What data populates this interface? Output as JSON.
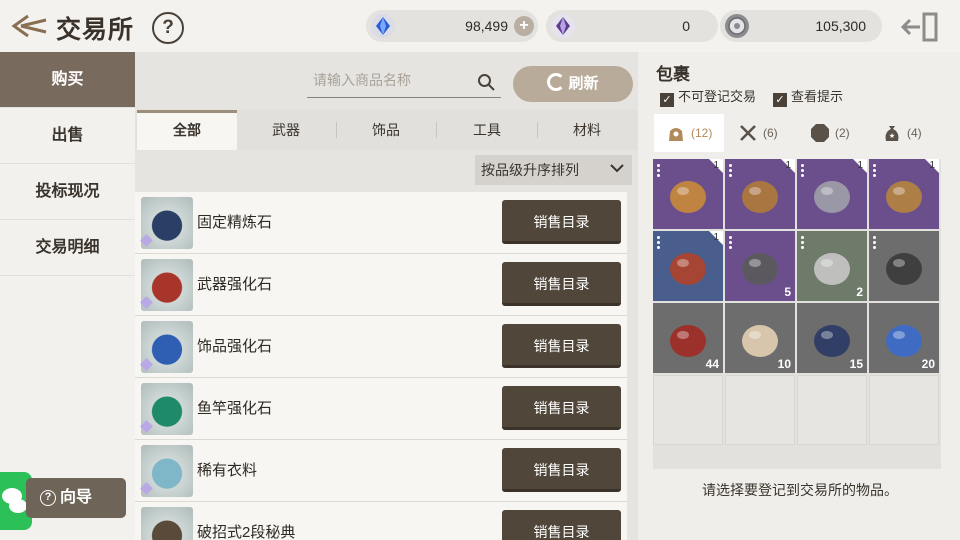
{
  "header": {
    "title": "交易所",
    "help_label": "?",
    "currencies": [
      {
        "name": "blue-crystal-icon",
        "value": "98,499",
        "has_plus": true
      },
      {
        "name": "purple-crystal-icon",
        "value": "0",
        "has_plus": false
      },
      {
        "name": "silver-coin-icon",
        "value": "105,300",
        "has_plus": false
      }
    ]
  },
  "nav": {
    "items": [
      {
        "label": "购买",
        "active": true
      },
      {
        "label": "出售",
        "active": false
      },
      {
        "label": "投标现况",
        "active": false
      },
      {
        "label": "交易明细",
        "active": false
      }
    ],
    "guide_label": "向导"
  },
  "market": {
    "search_placeholder": "请输入商品名称",
    "refresh_label": "刷新",
    "tabs": [
      "全部",
      "武器",
      "饰品",
      "工具",
      "材料"
    ],
    "active_tab": 0,
    "sort_label": "按品级升序排列",
    "rows": [
      {
        "name": "固定精炼石",
        "button": "销售目录",
        "color": "#2a3f66"
      },
      {
        "name": "武器强化石",
        "button": "销售目录",
        "color": "#a8352a"
      },
      {
        "name": "饰品强化石",
        "button": "销售目录",
        "color": "#2f5fb2"
      },
      {
        "name": "鱼竿强化石",
        "button": "销售目录",
        "color": "#1f8a6a"
      },
      {
        "name": "稀有衣料",
        "button": "销售目录",
        "color": "#7fb6c8"
      },
      {
        "name": "破招式2段秘典",
        "button": "销售目录",
        "color": "#5a4a3a"
      }
    ]
  },
  "bag": {
    "title": "包裹",
    "checkbox_1": "不可登记交易",
    "checkbox_2": "查看提示",
    "tabs": [
      {
        "icon": "bag-icon",
        "count": "(12)",
        "active": true
      },
      {
        "icon": "swords-icon",
        "count": "(6)",
        "active": false
      },
      {
        "icon": "octagon-icon",
        "count": "(2)",
        "active": false
      },
      {
        "icon": "pouch-icon",
        "count": "(4)",
        "active": false
      }
    ],
    "hint": "请选择要登记到交易所的物品。",
    "items": [
      {
        "name": "amulet-item",
        "qty": "1",
        "bg": "#6b4f8c",
        "fg": "#c9883a"
      },
      {
        "name": "earring-item",
        "qty": "1",
        "bg": "#6b4f8c",
        "fg": "#b07a3a"
      },
      {
        "name": "ring-item",
        "qty": "1",
        "bg": "#6b4f8c",
        "fg": "#a0a0a8"
      },
      {
        "name": "bracelet-item",
        "qty": "1",
        "bg": "#6b4f8c",
        "fg": "#b5833e"
      },
      {
        "name": "weapon-item",
        "qty": "1",
        "bg": "#4a5e8e",
        "fg": "#b0422a"
      },
      {
        "name": "chest-item",
        "qty": "5",
        "bg": "#6b4f8c",
        "fg": "#5a5a5a"
      },
      {
        "name": "pearl-item",
        "qty": "2",
        "bg": "#6f7b6a",
        "fg": "#c8c8c8"
      },
      {
        "name": "dagger-item",
        "qty": "",
        "bg": "#6d6d6d",
        "fg": "#3a3a3a"
      },
      {
        "name": "potion-item",
        "qty": "44",
        "bg": "#6d6d6d",
        "fg": "#a02a22"
      },
      {
        "name": "bun-item",
        "qty": "10",
        "bg": "#6d6d6d",
        "fg": "#e3cfb2"
      },
      {
        "name": "ore-item",
        "qty": "15",
        "bg": "#6d6d6d",
        "fg": "#2a3a66"
      },
      {
        "name": "flask-item",
        "qty": "20",
        "bg": "#6d6d6d",
        "fg": "#3a6acc"
      }
    ]
  }
}
